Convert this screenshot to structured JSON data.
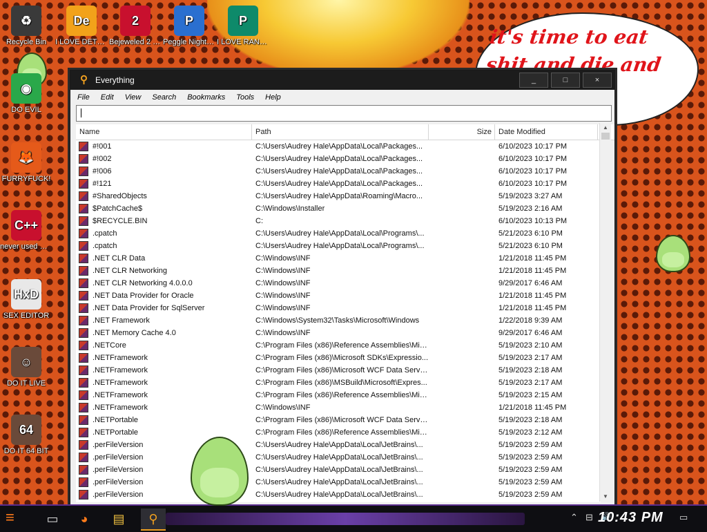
{
  "desktop": {
    "speech_text": "it's time to eat shit and die and chew",
    "speech_tail": "w",
    "icons": [
      {
        "label": "Recycle Bin",
        "bg": "#3a3a3a",
        "glyph": "♻"
      },
      {
        "label": "I LOVE DETECTING...",
        "bg": "#f2a21a",
        "glyph": "De"
      },
      {
        "label": "Bejeweled 2 Deluxe",
        "bg": "#c8102e",
        "glyph": "2"
      },
      {
        "label": "Peggle Nights Deluxe",
        "bg": "#2a6fd0",
        "glyph": "P"
      },
      {
        "label": "I LOVE RANSOMWARE",
        "bg": "#0e8a6a",
        "glyph": "P"
      },
      {
        "label": "DO EVIL",
        "bg": "#2aa84a",
        "glyph": "◉"
      },
      {
        "label": "FURRYFUCK!",
        "bg": "#e55a1a",
        "glyph": "🦊"
      },
      {
        "label": "never used why is it ...",
        "bg": "#c8102e",
        "glyph": "C++"
      },
      {
        "label": "SEX EDITOR",
        "bg": "#e8e8e8",
        "glyph": "HxD"
      },
      {
        "label": "DO IT LIVE",
        "bg": "#6a4a3a",
        "glyph": "☺"
      },
      {
        "label": "DO IT 64 BIT",
        "bg": "#6a4a3a",
        "glyph": "64"
      }
    ],
    "partial_labels": [
      "DE",
      "HA",
      "IL",
      "LAN",
      "SI",
      "FL",
      "B"
    ]
  },
  "window": {
    "title": "Everything",
    "controls": {
      "minimize": "_",
      "maximize": "□",
      "close": "×"
    },
    "menu": [
      "File",
      "Edit",
      "View",
      "Search",
      "Bookmarks",
      "Tools",
      "Help"
    ],
    "search_value": "",
    "columns": {
      "name": "Name",
      "path": "Path",
      "size": "Size",
      "date": "Date Modified"
    },
    "rows": [
      {
        "name": "#!001",
        "path": "C:\\Users\\Audrey Hale\\AppData\\Local\\Packages...",
        "size": "",
        "date": "6/10/2023 10:17 PM"
      },
      {
        "name": "#!002",
        "path": "C:\\Users\\Audrey Hale\\AppData\\Local\\Packages...",
        "size": "",
        "date": "6/10/2023 10:17 PM"
      },
      {
        "name": "#!006",
        "path": "C:\\Users\\Audrey Hale\\AppData\\Local\\Packages...",
        "size": "",
        "date": "6/10/2023 10:17 PM"
      },
      {
        "name": "#!121",
        "path": "C:\\Users\\Audrey Hale\\AppData\\Local\\Packages...",
        "size": "",
        "date": "6/10/2023 10:17 PM"
      },
      {
        "name": "#SharedObjects",
        "path": "C:\\Users\\Audrey Hale\\AppData\\Roaming\\Macro...",
        "size": "",
        "date": "5/19/2023 3:27 AM"
      },
      {
        "name": "$PatchCache$",
        "path": "C:\\Windows\\Installer",
        "size": "",
        "date": "5/19/2023 2:16 AM"
      },
      {
        "name": "$RECYCLE.BIN",
        "path": "C:",
        "size": "",
        "date": "6/10/2023 10:13 PM"
      },
      {
        "name": ".cpatch",
        "path": "C:\\Users\\Audrey Hale\\AppData\\Local\\Programs\\...",
        "size": "",
        "date": "5/21/2023 6:10 PM"
      },
      {
        "name": ".cpatch",
        "path": "C:\\Users\\Audrey Hale\\AppData\\Local\\Programs\\...",
        "size": "",
        "date": "5/21/2023 6:10 PM"
      },
      {
        "name": ".NET CLR Data",
        "path": "C:\\Windows\\INF",
        "size": "",
        "date": "1/21/2018 11:45 PM"
      },
      {
        "name": ".NET CLR Networking",
        "path": "C:\\Windows\\INF",
        "size": "",
        "date": "1/21/2018 11:45 PM"
      },
      {
        "name": ".NET CLR Networking 4.0.0.0",
        "path": "C:\\Windows\\INF",
        "size": "",
        "date": "9/29/2017 6:46 AM"
      },
      {
        "name": ".NET Data Provider for Oracle",
        "path": "C:\\Windows\\INF",
        "size": "",
        "date": "1/21/2018 11:45 PM"
      },
      {
        "name": ".NET Data Provider for SqlServer",
        "path": "C:\\Windows\\INF",
        "size": "",
        "date": "1/21/2018 11:45 PM"
      },
      {
        "name": ".NET Framework",
        "path": "C:\\Windows\\System32\\Tasks\\Microsoft\\Windows",
        "size": "",
        "date": "1/22/2018 9:39 AM"
      },
      {
        "name": ".NET Memory Cache 4.0",
        "path": "C:\\Windows\\INF",
        "size": "",
        "date": "9/29/2017 6:46 AM"
      },
      {
        "name": ".NETCore",
        "path": "C:\\Program Files (x86)\\Reference Assemblies\\Mic...",
        "size": "",
        "date": "5/19/2023 2:10 AM"
      },
      {
        "name": ".NETFramework",
        "path": "C:\\Program Files (x86)\\Microsoft SDKs\\Expressio...",
        "size": "",
        "date": "5/19/2023 2:17 AM"
      },
      {
        "name": ".NETFramework",
        "path": "C:\\Program Files (x86)\\Microsoft WCF Data Servic...",
        "size": "",
        "date": "5/19/2023 2:18 AM"
      },
      {
        "name": ".NETFramework",
        "path": "C:\\Program Files (x86)\\MSBuild\\Microsoft\\Expres...",
        "size": "",
        "date": "5/19/2023 2:17 AM"
      },
      {
        "name": ".NETFramework",
        "path": "C:\\Program Files (x86)\\Reference Assemblies\\Mic...",
        "size": "",
        "date": "5/19/2023 2:15 AM"
      },
      {
        "name": ".NETFramework",
        "path": "C:\\Windows\\INF",
        "size": "",
        "date": "1/21/2018 11:45 PM"
      },
      {
        "name": ".NETPortable",
        "path": "C:\\Program Files (x86)\\Microsoft WCF Data Servic...",
        "size": "",
        "date": "5/19/2023 2:18 AM"
      },
      {
        "name": ".NETPortable",
        "path": "C:\\Program Files (x86)\\Reference Assemblies\\Mic...",
        "size": "",
        "date": "5/19/2023 2:12 AM"
      },
      {
        "name": ".perFileVersion",
        "path": "C:\\Users\\Audrey Hale\\AppData\\Local\\JetBrains\\...",
        "size": "",
        "date": "5/19/2023 2:59 AM"
      },
      {
        "name": ".perFileVersion",
        "path": "C:\\Users\\Audrey Hale\\AppData\\Local\\JetBrains\\...",
        "size": "",
        "date": "5/19/2023 2:59 AM"
      },
      {
        "name": ".perFileVersion",
        "path": "C:\\Users\\Audrey Hale\\AppData\\Local\\JetBrains\\...",
        "size": "",
        "date": "5/19/2023 2:59 AM"
      },
      {
        "name": ".perFileVersion",
        "path": "C:\\Users\\Audrey Hale\\AppData\\Local\\JetBrains\\...",
        "size": "",
        "date": "5/19/2023 2:59 AM"
      },
      {
        "name": ".perFileVersion",
        "path": "C:\\Users\\Audrey Hale\\AppData\\Local\\JetBrains\\...",
        "size": "",
        "date": "5/19/2023 2:59 AM"
      }
    ]
  },
  "taskbar": {
    "apps": [
      {
        "name": "start-button",
        "glyph": "≡"
      },
      {
        "name": "blank-document-icon",
        "glyph": "▭"
      },
      {
        "name": "firefox-icon",
        "glyph": "◕"
      },
      {
        "name": "file-explorer-icon",
        "glyph": "▤"
      },
      {
        "name": "everything-search-icon",
        "glyph": "⚲"
      }
    ],
    "tray": {
      "chevron": "⌃",
      "network": "⊟",
      "volume": "🔊",
      "notifications": "▭"
    },
    "clock": "10:43 PM"
  }
}
